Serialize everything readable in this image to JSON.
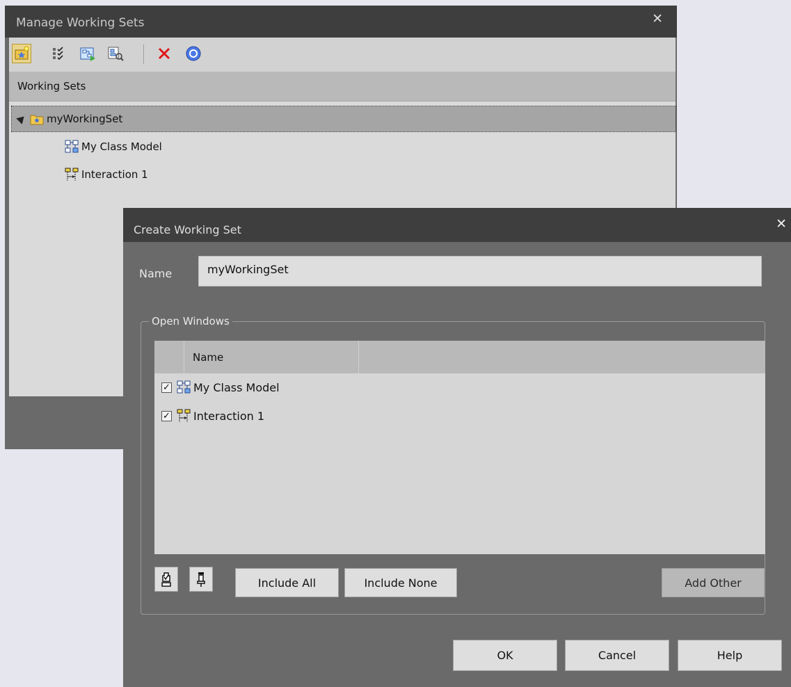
{
  "manage_window": {
    "title": "Manage Working Sets",
    "close_glyph": "✕",
    "toolbar": [
      "new-working-set-icon",
      "select-items-icon",
      "open-diagrams-icon",
      "find-element-icon",
      "delete-icon",
      "help-icon"
    ],
    "column_header": "Working Sets",
    "tree": {
      "root": "myWorkingSet",
      "children": [
        {
          "label": "My Class Model",
          "icon": "class-diagram-icon"
        },
        {
          "label": "Interaction 1",
          "icon": "interaction-diagram-icon"
        }
      ]
    }
  },
  "create_dialog": {
    "title": "Create Working Set",
    "close_glyph": "✕",
    "name_label": "Name",
    "name_value": "myWorkingSet",
    "group_label": "Open Windows",
    "list_header": "Name",
    "rows": [
      {
        "label": "My Class Model",
        "checked": true
      },
      {
        "label": "Interaction 1",
        "checked": true
      }
    ],
    "buttons": {
      "include_all": "Include All",
      "include_none": "Include None",
      "add_other": "Add Other",
      "ok": "OK",
      "cancel": "Cancel",
      "help": "Help"
    }
  }
}
